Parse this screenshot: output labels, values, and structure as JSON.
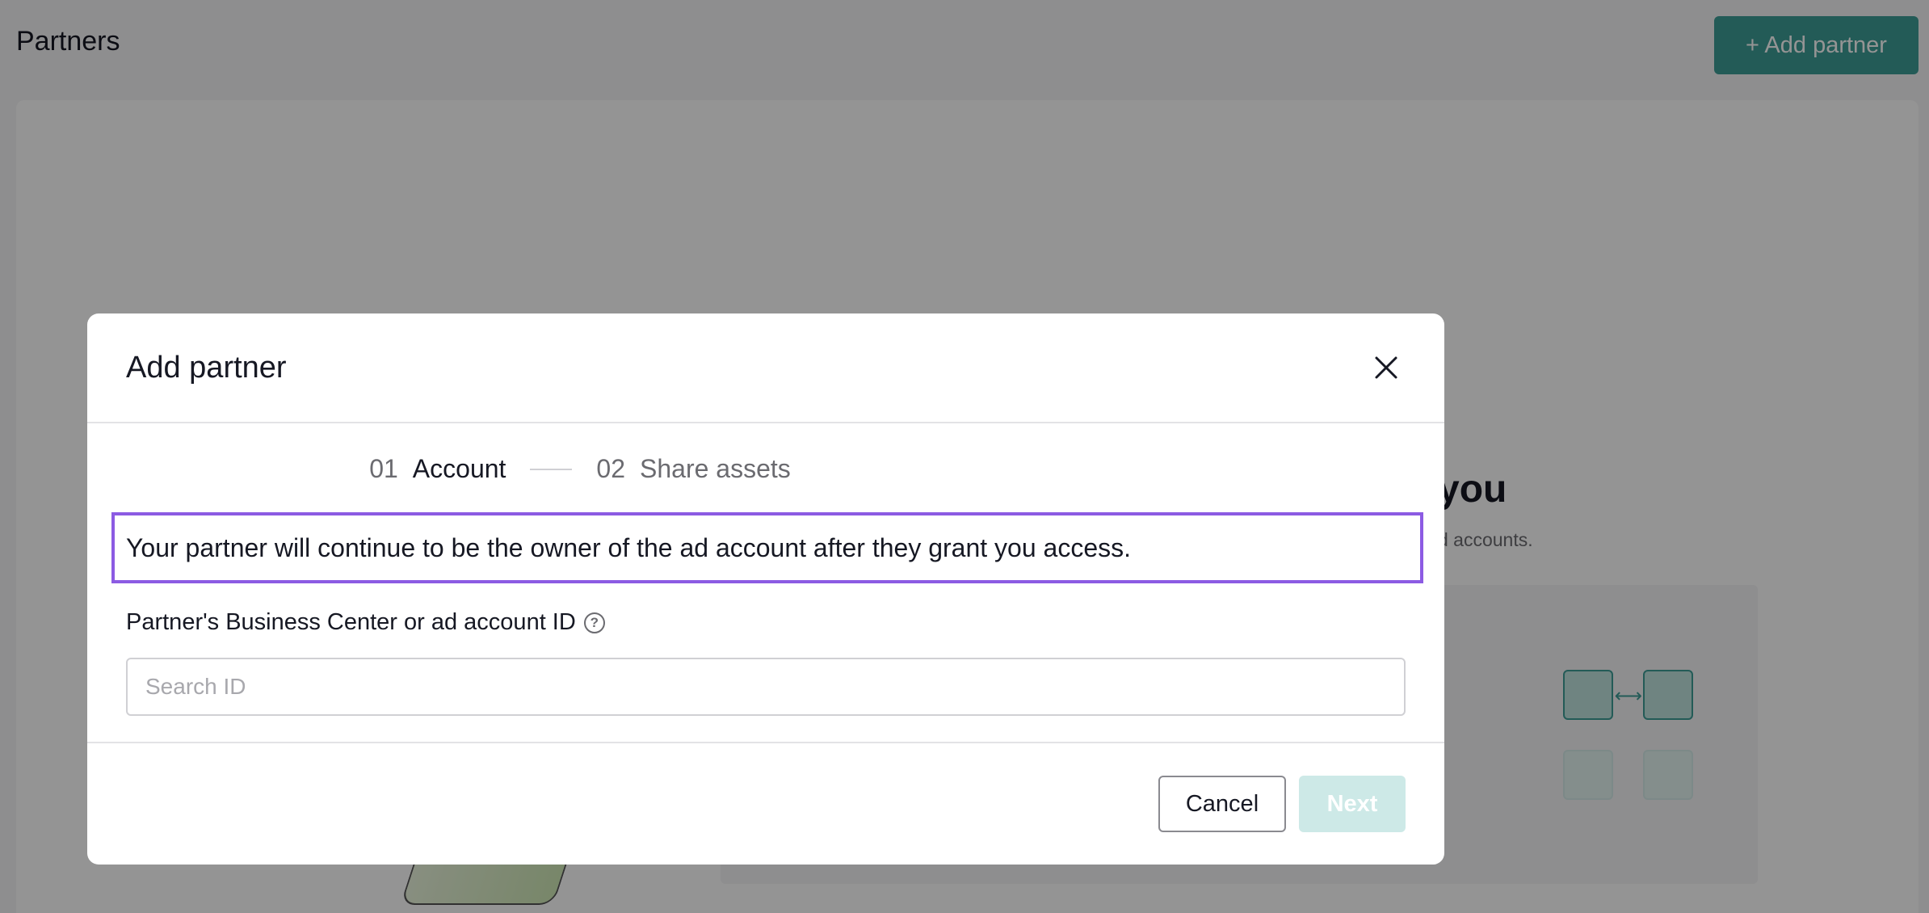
{
  "page": {
    "title": "Partners",
    "add_partner_label": "+ Add partner",
    "bg_heading_fragment": "you",
    "bg_sub_fragment": "d accounts."
  },
  "modal": {
    "title": "Add partner",
    "steps": [
      {
        "number": "01",
        "label": "Account",
        "active": true
      },
      {
        "number": "02",
        "label": "Share assets",
        "active": false
      }
    ],
    "notice": "Your partner will continue to be the owner of the ad account after they grant you access.",
    "field_label": "Partner's Business Center or ad account ID",
    "search_placeholder": "Search ID",
    "search_value": "",
    "cancel_label": "Cancel",
    "next_label": "Next"
  },
  "colors": {
    "accent": "#3d9d96",
    "highlight_border": "#8c5be3",
    "next_disabled": "#cde9e7"
  }
}
